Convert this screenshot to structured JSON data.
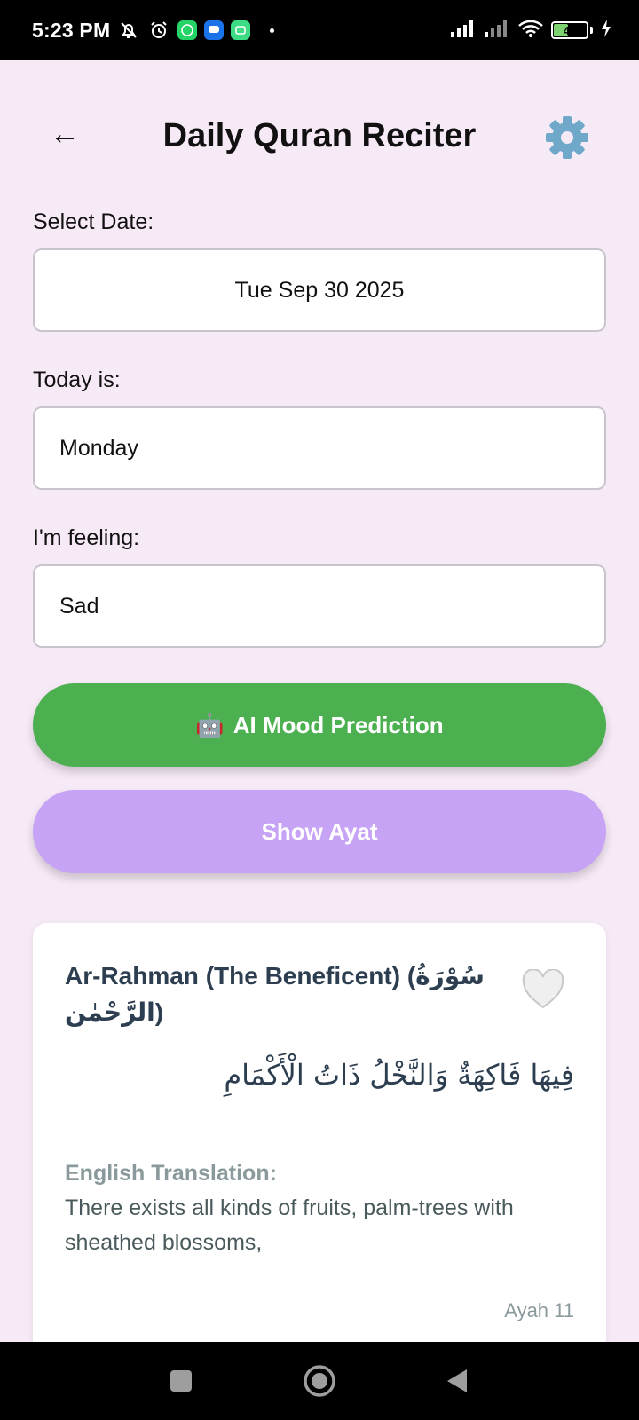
{
  "status_bar": {
    "time": "5:23 PM",
    "battery_level": "47",
    "battery_percent": 47,
    "icons": [
      "notifications-muted-icon",
      "alarm-icon",
      "whatsapp-icon",
      "messages-icon",
      "android-app-icon",
      "signal-icon",
      "signal-icon",
      "wifi-icon",
      "battery-icon",
      "charging-icon"
    ]
  },
  "header": {
    "back_symbol": "←",
    "title": "Daily Quran Reciter",
    "settings_icon": "gear-icon"
  },
  "form": {
    "date_label": "Select Date:",
    "date_value": "Tue Sep 30 2025",
    "day_label": "Today is:",
    "day_value": "Monday",
    "feeling_label": "I'm feeling:",
    "feeling_value": "Sad"
  },
  "buttons": {
    "ai_emoji": "🤖",
    "ai_label": "AI Mood Prediction",
    "ayat_label": "Show Ayat"
  },
  "ayah_card": {
    "surah_title": "Ar-Rahman (The Beneficent) (سُوْرَةُ الرَّحْمٰن)",
    "arabic_text": "فِيهَا فَاكِهَةٌ وَالنَّخْلُ ذَاتُ الْأَكْمَامِ",
    "translation_label": "English Translation:",
    "translation_text": "There exists all kinds of fruits, palm-trees with sheathed blossoms,",
    "ayah_number": "Ayah 11",
    "favorite_icon": "heart-outline-icon"
  },
  "nav_bar": {
    "buttons": [
      "recents-icon",
      "home-icon",
      "back-triangle-icon"
    ]
  },
  "colors": {
    "background": "#f7eaf7",
    "ai_button": "#4caf50",
    "ayat_button": "#c6a3f5",
    "title_text": "#2c3e50"
  }
}
